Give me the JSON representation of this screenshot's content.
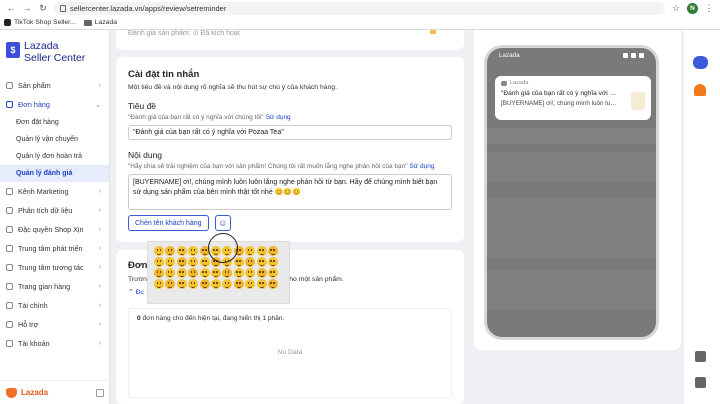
{
  "browser": {
    "url": "sellercenter.lazada.vn/apps/review/setreminder",
    "profile_initial": "N",
    "bookmarks": [
      "TikTok Shop Seller...",
      "Lazada"
    ]
  },
  "sidebar": {
    "brand_line1": "Lazada",
    "brand_line2": "Seller Center",
    "menu": [
      {
        "label": "Sản phẩm"
      },
      {
        "label": "Đơn hàng"
      }
    ],
    "submenu": [
      {
        "label": "Đơn đặt hàng"
      },
      {
        "label": "Quản lý vận chuyển"
      },
      {
        "label": "Quản lý đơn hoàn trả"
      },
      {
        "label": "Quản lý đánh giá"
      }
    ],
    "menu2": [
      {
        "label": "Kênh Marketing"
      },
      {
        "label": "Phân tích dữ liệu"
      },
      {
        "label": "Đặc quyền Shop Xịn"
      },
      {
        "label": "Trung tâm phát triển"
      },
      {
        "label": "Trung tâm tương tác"
      },
      {
        "label": "Trang gian hàng"
      },
      {
        "label": "Tài chính"
      },
      {
        "label": "Hỗ trợ"
      },
      {
        "label": "Tài khoản"
      }
    ],
    "footer_brand": "Lazada"
  },
  "top_card": {
    "faded_text": "Đánh giá sản phẩm: ⊙ Đã kích hoạt"
  },
  "settings": {
    "title": "Cài đặt tin nhắn",
    "description": "Một tiêu đề và nội dung rõ nghĩa sẽ thu hút sự chú ý của khách hàng.",
    "subject_label": "Tiêu đề",
    "subject_hint": "\"Đánh giá của bạn rất có ý nghĩa với chúng tôi\"",
    "use_link": "Sử dụng",
    "subject_value": "\"Đánh giá của bạn rất có ý nghĩa với Pozaa Tea\"",
    "content_label": "Nội dung",
    "content_hint": "\"Hãy chia sẻ trải nghiệm của bạn với sản phẩm! Chúng tôi rất muốn lắng nghe phản hồi của bạn\"",
    "content_value": "[BUYERNAME] ơi!, chúng mình luôn luôn lắng nghe phản hồi từ bạn. Hãy để chúng mình biết bạn sử dụng sản phẩm của bên mình thật tốt nhé 😊😊😊",
    "insert_button": "Chèn tên khách hàng",
    "emoji_icon": "smiley-icon"
  },
  "orders": {
    "title": "Đơn",
    "description_prefix": "Trườn",
    "description_suffix": "g báo cho một sản phẩm.",
    "toggle": "Đc",
    "count_number": "0",
    "count_text": "đơn hàng cho đến hiện tại, đang hiển thị 1 phần.",
    "no_data": "No Data"
  },
  "phone_preview": {
    "carrier": "Lazada",
    "app_name": "Lazada",
    "notif_title": "\"Đánh giá của bạn rất có ý nghĩa với Po...",
    "notif_body": "[BUYERNAME] ơi!, chúng mình luôn luôn lắ..."
  },
  "emoji_picker": {
    "rows": 4,
    "cols": 11
  },
  "colors": {
    "brand_blue": "#1a3fc7",
    "lazada_orange": "#f27025",
    "selected_bg": "#e6ecfb"
  }
}
